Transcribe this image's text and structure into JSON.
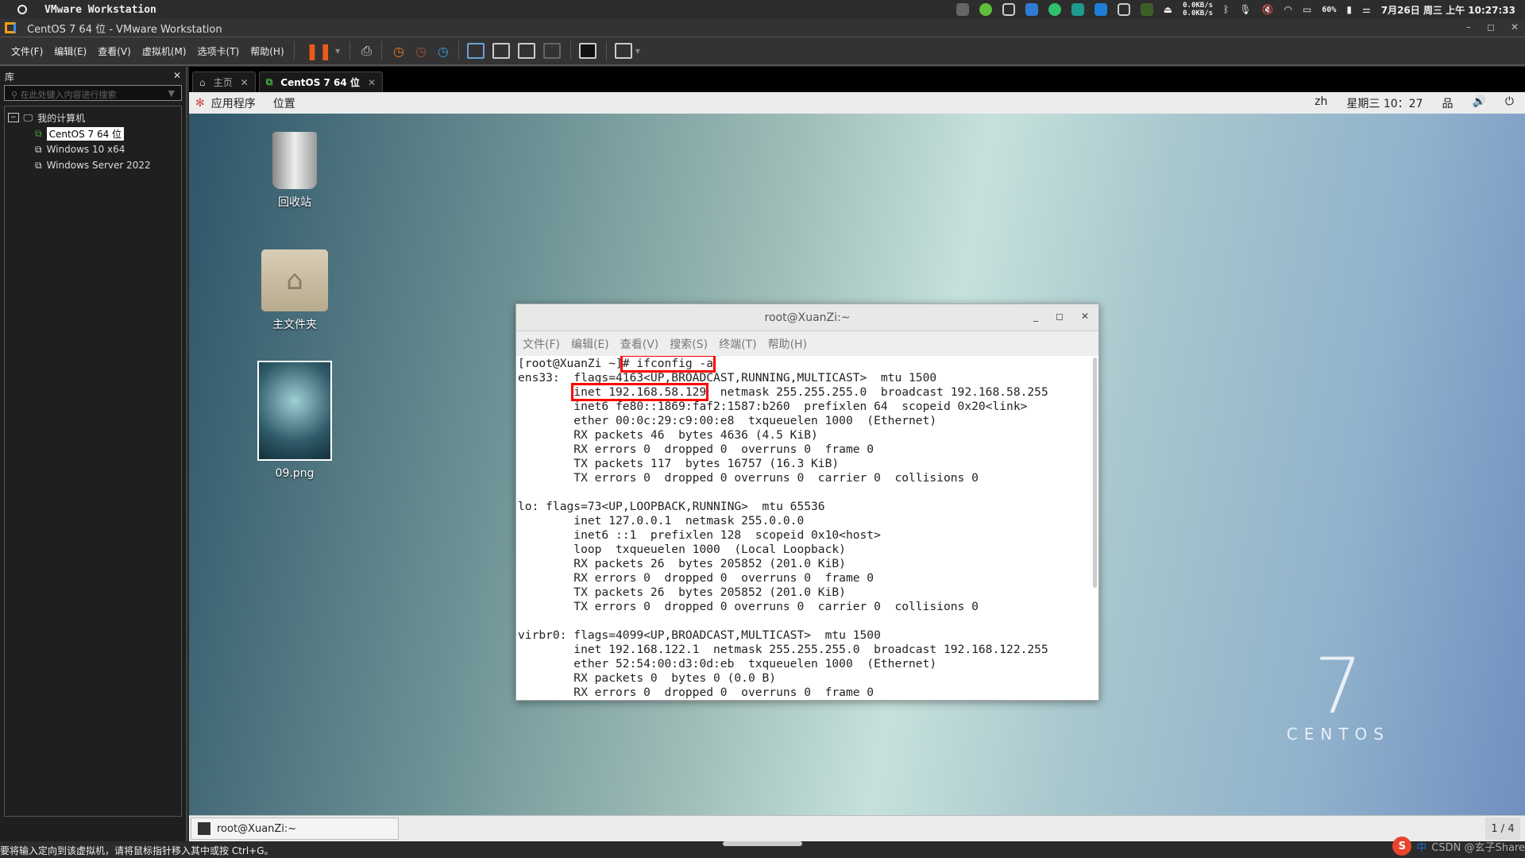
{
  "host_bar": {
    "app": "VMware Workstation",
    "net_up": "0.0KB/s",
    "net_down": "0.0KB/s",
    "battery": "60%",
    "datetime": "7月26日 周三 上午 10:27:33"
  },
  "window": {
    "title": "CentOS 7 64 位 - VMware Workstation"
  },
  "menu": [
    "文件(F)",
    "编辑(E)",
    "查看(V)",
    "虚拟机(M)",
    "选项卡(T)",
    "帮助(H)"
  ],
  "library": {
    "title": "库",
    "search_placeholder": "在此处键入内容进行搜索",
    "root": "我的计算机",
    "vms": [
      "CentOS 7 64 位",
      "Windows 10 x64",
      "Windows Server 2022"
    ]
  },
  "tabs": [
    {
      "label": "主页"
    },
    {
      "label": "CentOS 7 64 位"
    }
  ],
  "guest": {
    "top_menu": [
      "应用程序",
      "位置"
    ],
    "lang": "zh",
    "clock": "星期三 10：27",
    "desktop_icons": [
      "回收站",
      "主文件夹",
      "09.png"
    ],
    "brand_number": "7",
    "brand_text": "CENTOS",
    "taskbar_item": "root@XuanZi:~",
    "pager": "1 / 4"
  },
  "terminal": {
    "title": "root@XuanZi:~",
    "menu": [
      "文件(F)",
      "编辑(E)",
      "查看(V)",
      "搜索(S)",
      "终端(T)",
      "帮助(H)"
    ],
    "prompt": "[root@XuanZi ~]",
    "command": "# ifconfig -a",
    "ens33_head": "ens33:  flags=4163<UP,BROADCAST,RUNNING,MULTICAST>  mtu 1500",
    "ens33_inet": "inet 192.168.58.129",
    "ens33_inet_rest": "  netmask 255.255.255.0  broadcast 192.168.58.255",
    "lines": [
      "        inet6 fe80::1869:faf2:1587:b260  prefixlen 64  scopeid 0x20<link>",
      "        ether 00:0c:29:c9:00:e8  txqueuelen 1000  (Ethernet)",
      "        RX packets 46  bytes 4636 (4.5 KiB)",
      "        RX errors 0  dropped 0  overruns 0  frame 0",
      "        TX packets 117  bytes 16757 (16.3 KiB)",
      "        TX errors 0  dropped 0 overruns 0  carrier 0  collisions 0",
      "",
      "lo: flags=73<UP,LOOPBACK,RUNNING>  mtu 65536",
      "        inet 127.0.0.1  netmask 255.0.0.0",
      "        inet6 ::1  prefixlen 128  scopeid 0x10<host>",
      "        loop  txqueuelen 1000  (Local Loopback)",
      "        RX packets 26  bytes 205852 (201.0 KiB)",
      "        RX errors 0  dropped 0  overruns 0  frame 0",
      "        TX packets 26  bytes 205852 (201.0 KiB)",
      "        TX errors 0  dropped 0 overruns 0  carrier 0  collisions 0",
      "",
      "virbr0: flags=4099<UP,BROADCAST,MULTICAST>  mtu 1500",
      "        inet 192.168.122.1  netmask 255.255.255.0  broadcast 192.168.122.255",
      "        ether 52:54:00:d3:0d:eb  txqueuelen 1000  (Ethernet)",
      "        RX packets 0  bytes 0 (0.0 B)",
      "        RX errors 0  dropped 0  overruns 0  frame 0"
    ]
  },
  "status_bar": "要将输入定向到该虚拟机，请将鼠标指针移入其中或按 Ctrl+G。",
  "ime": {
    "label": "中",
    "watermark": "CSDN @玄子Share"
  }
}
